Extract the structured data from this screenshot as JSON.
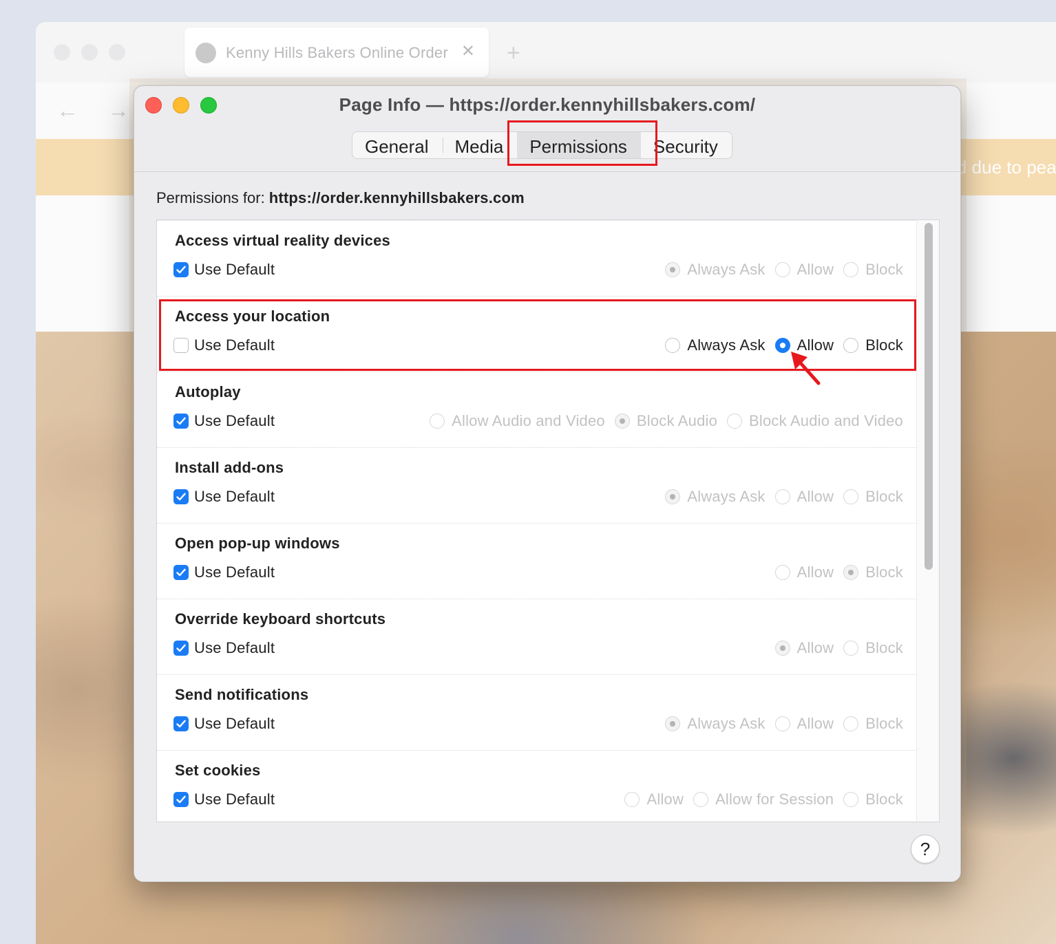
{
  "browser": {
    "tab_title": "Kenny Hills Bakers Online Order",
    "favicon_text": "KENNY HILLS BAKERS",
    "banner_text": "d due to pea"
  },
  "dialog": {
    "title": "Page Info — https://order.kennyhillsbakers.com/",
    "tabs": [
      "General",
      "Media",
      "Permissions",
      "Security"
    ],
    "selected_tab": "Permissions",
    "permissions_for_label": "Permissions for:",
    "permissions_for_url": "https://order.kennyhillsbakers.com",
    "help_label": "?",
    "permissions": [
      {
        "title": "Access virtual reality devices",
        "use_default_label": "Use Default",
        "use_default": true,
        "options": [
          "Always Ask",
          "Allow",
          "Block"
        ],
        "selected": "Always Ask"
      },
      {
        "title": "Access your location",
        "use_default_label": "Use Default",
        "use_default": false,
        "options": [
          "Always Ask",
          "Allow",
          "Block"
        ],
        "selected": "Allow"
      },
      {
        "title": "Autoplay",
        "use_default_label": "Use Default",
        "use_default": true,
        "options": [
          "Allow Audio and Video",
          "Block Audio",
          "Block Audio and Video"
        ],
        "selected": "Block Audio"
      },
      {
        "title": "Install add-ons",
        "use_default_label": "Use Default",
        "use_default": true,
        "options": [
          "Always Ask",
          "Allow",
          "Block"
        ],
        "selected": "Always Ask"
      },
      {
        "title": "Open pop-up windows",
        "use_default_label": "Use Default",
        "use_default": true,
        "options": [
          "Allow",
          "Block"
        ],
        "selected": "Block"
      },
      {
        "title": "Override keyboard shortcuts",
        "use_default_label": "Use Default",
        "use_default": true,
        "options": [
          "Allow",
          "Block"
        ],
        "selected": "Allow"
      },
      {
        "title": "Send notifications",
        "use_default_label": "Use Default",
        "use_default": true,
        "options": [
          "Always Ask",
          "Allow",
          "Block"
        ],
        "selected": "Always Ask"
      },
      {
        "title": "Set cookies",
        "use_default_label": "Use Default",
        "use_default": true,
        "options": [
          "Allow",
          "Allow for Session",
          "Block"
        ],
        "selected": null
      }
    ]
  },
  "colors": {
    "accent": "#1a7cf5",
    "highlight": "#e6191e",
    "traffic_red": "#fe5f57",
    "traffic_yellow": "#febc2e",
    "traffic_green": "#28c840"
  }
}
